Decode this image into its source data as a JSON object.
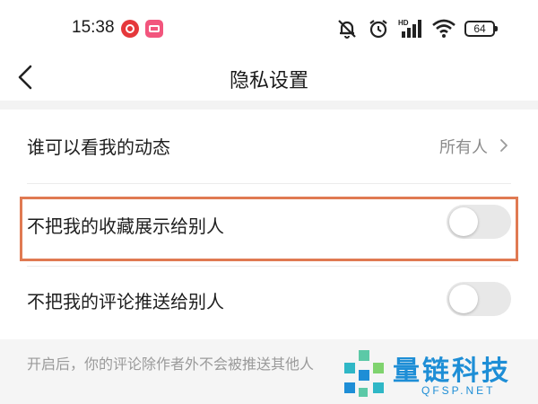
{
  "status_bar": {
    "time": "15:38",
    "battery": "64",
    "hd_label": "HD",
    "icons": [
      "netease-music-app-icon",
      "pink-app-icon",
      "mute-bell-icon",
      "alarm-icon",
      "signal-icon",
      "wifi-icon",
      "battery-icon"
    ]
  },
  "header": {
    "title": "隐私设置",
    "back_icon": "chevron-left-icon"
  },
  "settings": {
    "who_can_see": {
      "label": "谁可以看我的动态",
      "value": "所有人"
    },
    "hide_favorites": {
      "label": "不把我的收藏展示给别人",
      "enabled": false
    },
    "hide_comments": {
      "label": "不把我的评论推送给别人",
      "enabled": false
    },
    "footnote": "开启后，你的评论除作者外不会被推送其他人"
  },
  "highlight_color": "#e07a52",
  "toggle_off_color": "#e8e8e8",
  "watermark": {
    "name": "量链科技",
    "url": "QFSP.NET",
    "color": "#1e8ed6"
  }
}
